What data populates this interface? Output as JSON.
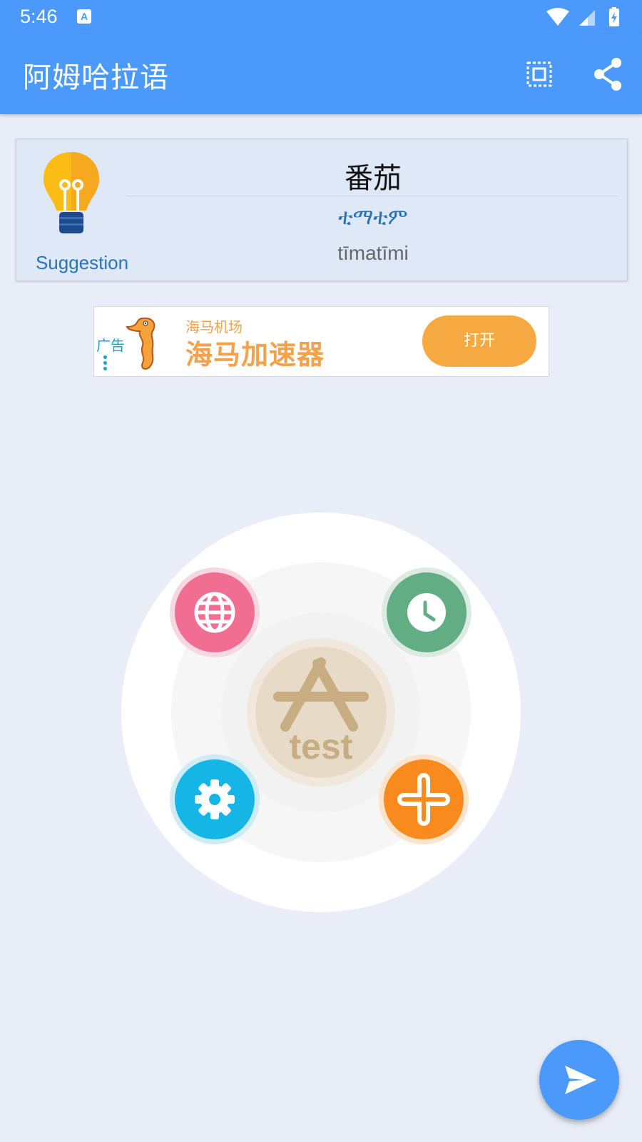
{
  "status_bar": {
    "time": "5:46",
    "notification_icon": "a-icon",
    "system_icons": [
      "wifi-icon",
      "signal-icon",
      "battery-icon"
    ]
  },
  "app_bar": {
    "title": "阿姆哈拉语",
    "actions": [
      "fullscreen-icon",
      "share-icon"
    ],
    "color": "#4a99fb"
  },
  "suggestion_card": {
    "label": "Suggestion",
    "word": "番茄",
    "translation": "ቲማቲም",
    "romanization": "tīmatīmi",
    "icon": "lightbulb-icon"
  },
  "ad_banner": {
    "tag": "广告",
    "subtitle": "海马机场",
    "title": "海马加速器",
    "button": "打开",
    "accent": "#f7a941"
  },
  "menu_wheel": {
    "center_label": "test",
    "buttons": [
      {
        "name": "globe-button",
        "icon": "globe-icon",
        "color": "#f26d92"
      },
      {
        "name": "history-button",
        "icon": "clock-icon",
        "color": "#63ad84"
      },
      {
        "name": "settings-button",
        "icon": "gear-icon",
        "color": "#15b6e5"
      },
      {
        "name": "add-button",
        "icon": "plus-icon",
        "color": "#f98b1e"
      }
    ]
  },
  "fab": {
    "icon": "send-icon",
    "color": "#4a99fb"
  }
}
